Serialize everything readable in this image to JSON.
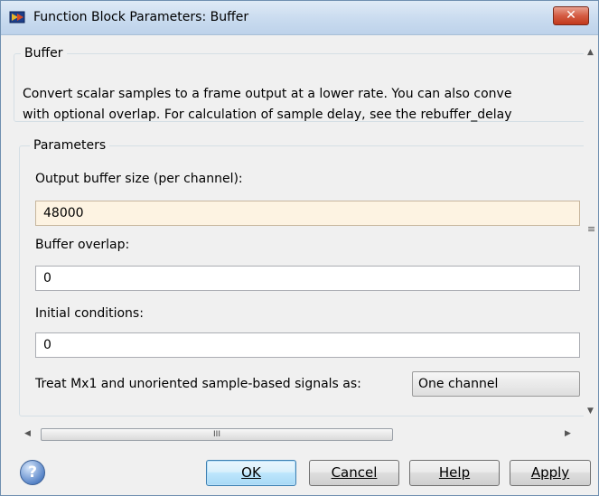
{
  "window": {
    "title": "Function Block Parameters: Buffer",
    "close_label": "✕"
  },
  "description": {
    "group_title": "Buffer",
    "line1": "Convert scalar samples to a frame output at a lower rate. You can also conve",
    "line2": "with optional overlap. For calculation of sample delay, see the rebuffer_delay"
  },
  "parameters": {
    "group_title": "Parameters",
    "output_buffer_size_label": "Output buffer size (per channel):",
    "output_buffer_size_value": "48000",
    "buffer_overlap_label": "Buffer overlap:",
    "buffer_overlap_value": "0",
    "initial_conditions_label": "Initial conditions:",
    "initial_conditions_value": "0",
    "treat_label": "Treat Mx1 and unoriented sample-based signals as:",
    "treat_value": "One channel"
  },
  "hscroll": {
    "thumb_grip": "III"
  },
  "buttons": {
    "ok": "OK",
    "cancel": "Cancel",
    "help": "Help",
    "apply": "Apply",
    "help_icon": "?"
  },
  "colors": {
    "focused_field": "#fdf3e2",
    "close_button": "#c7432b"
  }
}
